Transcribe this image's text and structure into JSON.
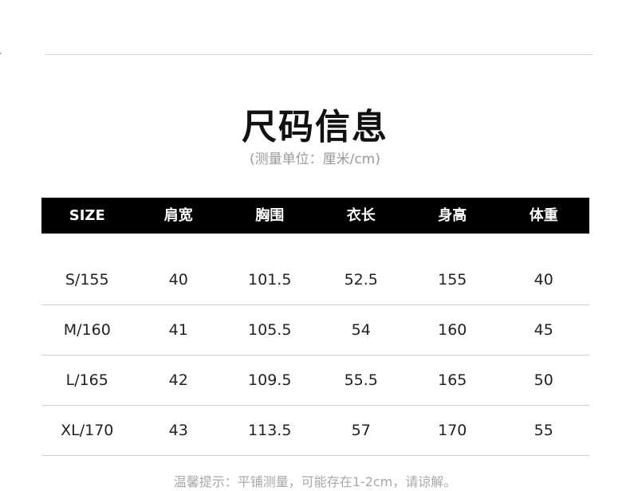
{
  "title": "尺码信息",
  "subtitle": "(测量单位：厘米/cm)",
  "table": {
    "headers": [
      "SIZE",
      "肩宽",
      "胸围",
      "衣长",
      "身高",
      "体重"
    ],
    "rows": [
      [
        "S/155",
        "40",
        "101.5",
        "52.5",
        "155",
        "40"
      ],
      [
        "M/160",
        "41",
        "105.5",
        "54",
        "160",
        "45"
      ],
      [
        "L/165",
        "42",
        "109.5",
        "55.5",
        "165",
        "50"
      ],
      [
        "XL/170",
        "43",
        "113.5",
        "57",
        "170",
        "55"
      ]
    ]
  },
  "note": "温馨提示：平铺测量，可能存在1-2cm，请谅解。"
}
